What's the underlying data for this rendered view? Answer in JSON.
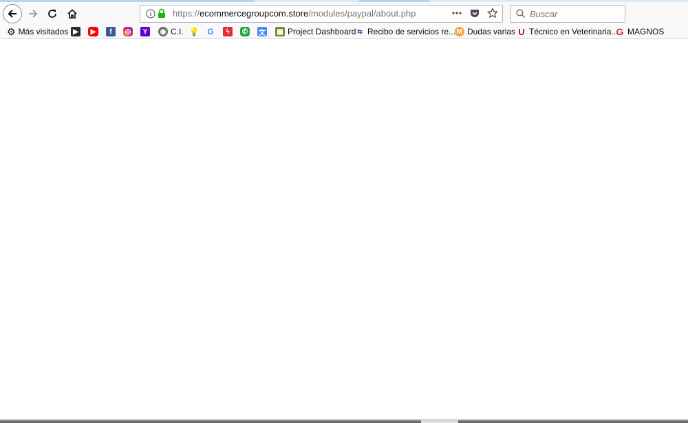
{
  "url": {
    "scheme": "https://",
    "host": "ecommercegroupcom.store",
    "path": "/modules/paypal/about.php"
  },
  "search": {
    "placeholder": "Buscar"
  },
  "bookmarks": {
    "most_visited": "Más visitados",
    "ci": "C.I.",
    "project_dashboard": "Project Dashboard",
    "recibo": "Recibo de servicios re...",
    "dudas": "Dudas varias",
    "tecnico": "Técnico en Veterinaria...",
    "magnos": "MAGNOS"
  },
  "colors": {
    "lock": "#12bc00",
    "youtube": "#ff0000",
    "facebook": "#3b5998",
    "yahoo": "#5f01d1",
    "magnos": "#d32f2f"
  }
}
